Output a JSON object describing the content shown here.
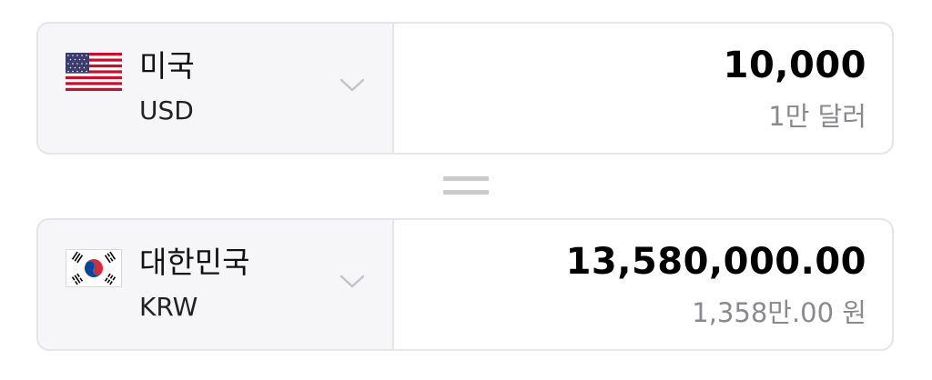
{
  "from": {
    "country": "미국",
    "code": "USD",
    "amount": "10,000",
    "amount_words": "1만 달러",
    "flag_icon": "us-flag-icon"
  },
  "to": {
    "country": "대한민국",
    "code": "KRW",
    "amount": "13,580,000.00",
    "amount_words": "1,358만.00 원",
    "flag_icon": "kr-flag-icon"
  },
  "equals_icon": "equals-icon",
  "colors": {
    "border": "#e4e4e9",
    "selector_bg": "#f6f6f8",
    "secondary_text": "#8a8a8e",
    "us_red": "#c8102e",
    "us_blue": "#3c3b6e",
    "kr_red": "#cd2e3a",
    "kr_blue": "#0047a0"
  }
}
